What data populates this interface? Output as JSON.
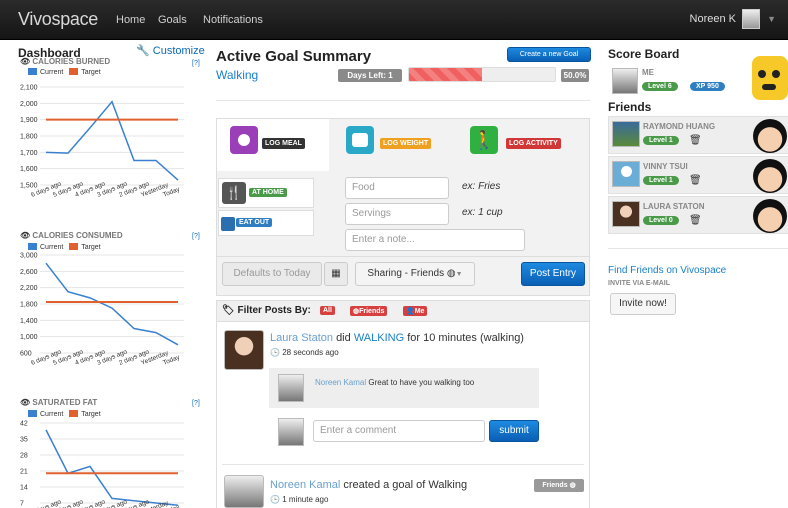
{
  "nav": {
    "brand": "Vivospace",
    "links": [
      "Home",
      "Goals",
      "Notifications"
    ],
    "user": "Noreen K"
  },
  "dashboard": {
    "title": "Dashboard",
    "customize": "Customize",
    "help": "[?]",
    "legend_current": "Current",
    "legend_target": "Target",
    "x_labels": [
      "6 days ago",
      "5 days ago",
      "4 days ago",
      "3 days ago",
      "2 days ago",
      "Yesterday",
      "Today"
    ],
    "colors": {
      "current": "#3a80d0",
      "target": "#e06030"
    }
  },
  "chart_data": [
    {
      "type": "line",
      "title": "CALORIES BURNED",
      "categories": [
        "6 days ago",
        "5 days ago",
        "4 days ago",
        "3 days ago",
        "2 days ago",
        "Yesterday",
        "Today"
      ],
      "y_ticks": [
        "2,100",
        "2,000",
        "1,900",
        "1,800",
        "1,700",
        "1,600",
        "1,500"
      ],
      "ylim": [
        1500,
        2100
      ],
      "series": [
        {
          "name": "Current",
          "values": [
            1700,
            1695,
            1850,
            2010,
            1650,
            1650,
            1530
          ]
        },
        {
          "name": "Target",
          "values": [
            1900,
            1900,
            1900,
            1900,
            1900,
            1900,
            1900
          ]
        }
      ]
    },
    {
      "type": "line",
      "title": "CALORIES CONSUMED",
      "categories": [
        "6 days ago",
        "5 days ago",
        "4 days ago",
        "3 days ago",
        "2 days ago",
        "Yesterday",
        "Today"
      ],
      "y_ticks": [
        "3,000",
        "2,600",
        "2,200",
        "1,800",
        "1,400",
        "1,000",
        "600"
      ],
      "ylim": [
        600,
        3000
      ],
      "series": [
        {
          "name": "Current",
          "values": [
            2800,
            2100,
            1950,
            1700,
            1200,
            1100,
            800
          ]
        },
        {
          "name": "Target",
          "values": [
            1850,
            1850,
            1850,
            1850,
            1850,
            1850,
            1850
          ]
        }
      ]
    },
    {
      "type": "line",
      "title": "SATURATED FAT",
      "categories": [
        "6 days ago",
        "5 days ago",
        "4 days ago",
        "3 days ago",
        "2 days ago",
        "Yesterday",
        "Today"
      ],
      "y_ticks": [
        "42",
        "35",
        "28",
        "21",
        "14",
        "7"
      ],
      "ylim": [
        7,
        42
      ],
      "series": [
        {
          "name": "Current",
          "values": [
            39,
            20,
            23,
            9,
            8,
            7,
            6
          ]
        },
        {
          "name": "Target",
          "values": [
            20,
            20,
            20,
            20,
            20,
            20,
            20
          ]
        }
      ]
    }
  ],
  "summary": {
    "title": "Active Goal Summary",
    "goal": "Walking",
    "new_goal": "Create a new Goal",
    "days_left": "Days Left: 1",
    "progress_pct": "50.0%",
    "progress": 0.5
  },
  "tabs": [
    {
      "label": "LOG MEAL",
      "color": "#9a3fb8"
    },
    {
      "label": "LOG WEIGHT",
      "color": "#f0a020"
    },
    {
      "label": "LOG ACTIVITY",
      "color": "#d03838"
    }
  ],
  "subtabs": [
    "AT HOME",
    "EAT OUT"
  ],
  "form": {
    "food_placeholder": "Food",
    "food_example": "ex: Fries",
    "servings_placeholder": "Servings",
    "servings_example": "ex: 1 cup",
    "note_placeholder": "Enter a note...",
    "date_default": "Defaults to Today",
    "sharing": "Sharing - Friends",
    "post": "Post Entry"
  },
  "filter": {
    "label": "Filter Posts By:",
    "all": "All",
    "friends": "Friends",
    "me": "Me"
  },
  "feed": [
    {
      "name": "Laura Staton",
      "verb": "did",
      "activity": "WALKING",
      "rest": "for 10 minutes (walking)",
      "time": "28 seconds ago"
    },
    {
      "name": "Noreen Kamal",
      "verb": "created a goal of Walking",
      "time": "1 minute ago",
      "badge": "Friends"
    }
  ],
  "comment": {
    "author": "Noreen Kamal",
    "text": "Great to have you walking too"
  },
  "comment_input": {
    "placeholder": "Enter a comment",
    "submit": "submit"
  },
  "scoreboard": {
    "title": "Score Board",
    "me": {
      "name": "ME",
      "level": "Level 6",
      "xp": "XP 950"
    },
    "friends_title": "Friends",
    "friends": [
      {
        "name": "RAYMOND HUANG",
        "level": "Level 1"
      },
      {
        "name": "VINNY TSUI",
        "level": "Level 1"
      },
      {
        "name": "LAURA STATON",
        "level": "Level 0"
      }
    ],
    "find": "Find Friends on Vivospace",
    "invite_title": "INVITE VIA E-MAIL",
    "invite_button": "Invite now!"
  }
}
